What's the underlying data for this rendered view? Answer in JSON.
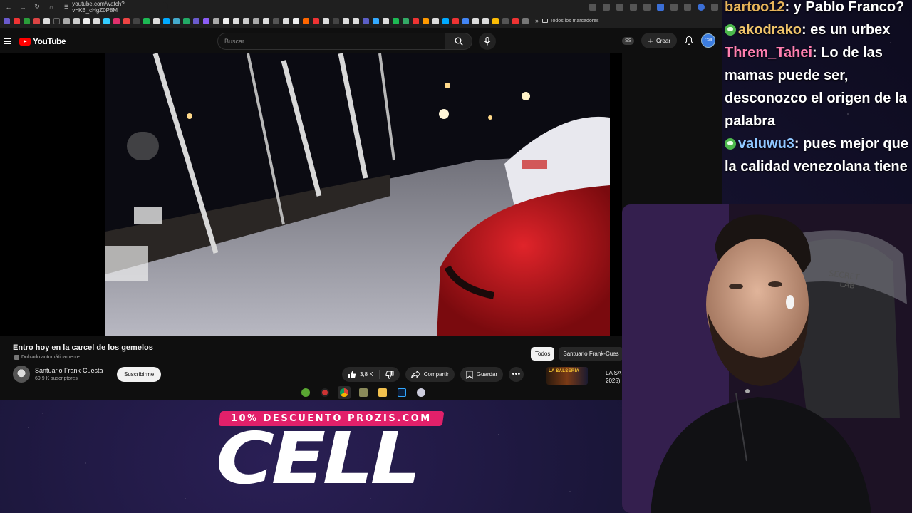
{
  "browser": {
    "url": "youtube.com/watch?v=KB_cHgZ0P8M",
    "bookmarks_folder": "Todos los marcadores"
  },
  "youtube": {
    "logo_text": "YouTube",
    "search_placeholder": "Buscar",
    "ss_badge": "SS",
    "create_label": "Crear",
    "avatar_text": "Cell"
  },
  "video": {
    "title": "Entro hoy en la carcel de los gemelos",
    "dub_label": "Doblado automáticamente",
    "channel": "Santuario Frank-Cuesta",
    "subscribers": "69,9 K suscriptores",
    "subscribe_label": "Suscribirme",
    "likes": "3,8 K",
    "share_label": "Compartir",
    "save_label": "Guardar"
  },
  "sidebar": {
    "chips": [
      "Todos",
      "Santuario Frank-Cues"
    ],
    "recommendation": {
      "thumb_text": "LA SALSERÍA",
      "title_line1": "LA SA",
      "title_line2": "2025)"
    }
  },
  "chat": {
    "messages": [
      {
        "user": "bartoo12",
        "text": ": y Pablo Franco?",
        "color": "#e6b35a",
        "badge": false
      },
      {
        "user": "akodrako",
        "text": ": es un urbex",
        "color": "#f0c46a",
        "badge": true
      },
      {
        "user": "Threm_Tahei",
        "text": ": Lo de las mamas puede ser, desconozco el origen de la palabra",
        "color": "#ff7fb0",
        "badge": false
      },
      {
        "user": "valuwu3",
        "text": ": pues mejor que la calidad venezolana tiene",
        "color": "#8fc7ff",
        "badge": true
      }
    ]
  },
  "promo": {
    "tag": "10% DESCUENTO PROZIS.COM",
    "brand": "CELL"
  },
  "colors": {
    "yt_red": "#ff0000",
    "promo_pink": "#e2206a"
  }
}
